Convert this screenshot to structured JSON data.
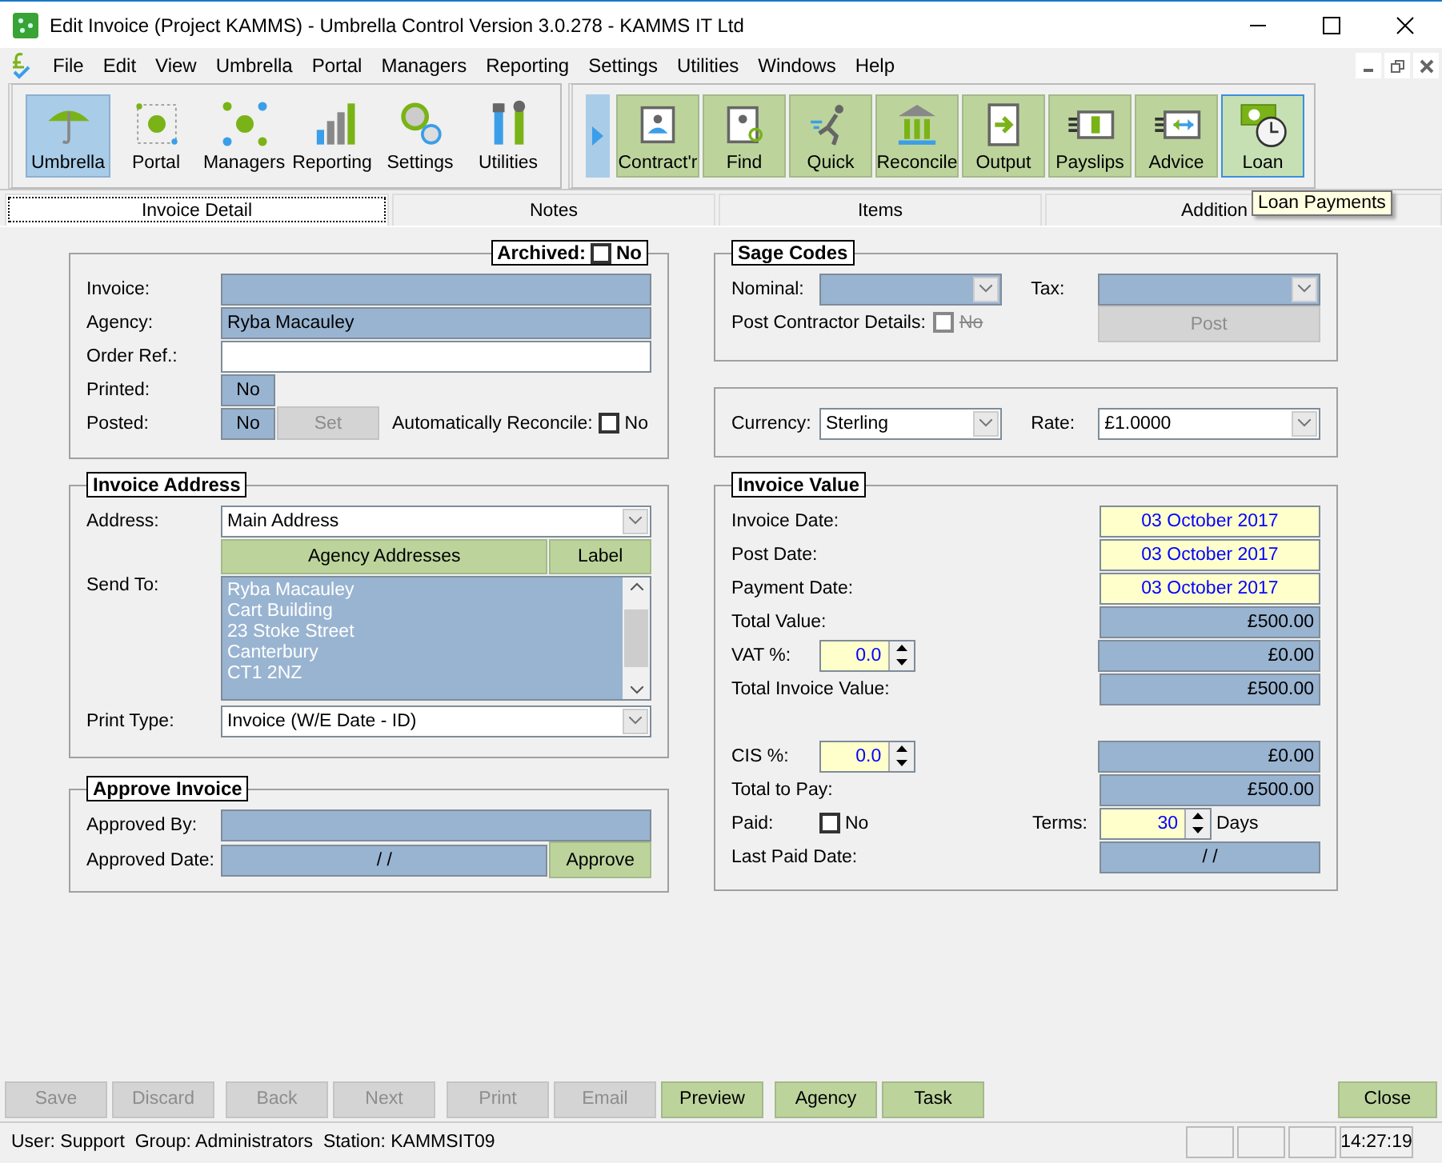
{
  "window": {
    "title": "Edit Invoice (Project KAMMS) - Umbrella Control Version 3.0.278 - KAMMS IT Ltd"
  },
  "menu": [
    "File",
    "Edit",
    "View",
    "Umbrella",
    "Portal",
    "Managers",
    "Reporting",
    "Settings",
    "Utilities",
    "Windows",
    "Help"
  ],
  "toolbar_main": [
    {
      "label": "Umbrella",
      "selected": true
    },
    {
      "label": "Portal",
      "selected": false
    },
    {
      "label": "Managers",
      "selected": false
    },
    {
      "label": "Reporting",
      "selected": false
    },
    {
      "label": "Settings",
      "selected": false
    },
    {
      "label": "Utilities",
      "selected": false
    }
  ],
  "toolbar_actions": [
    {
      "label": "Contract'r",
      "selected": false
    },
    {
      "label": "Find",
      "selected": false
    },
    {
      "label": "Quick",
      "selected": false
    },
    {
      "label": "Reconcile",
      "selected": false
    },
    {
      "label": "Output",
      "selected": false
    },
    {
      "label": "Payslips",
      "selected": false
    },
    {
      "label": "Advice",
      "selected": false
    },
    {
      "label": "Loan",
      "selected": true
    }
  ],
  "tooltip": "Loan Payments",
  "tabs": [
    {
      "label": "Invoice Detail",
      "selected": true
    },
    {
      "label": "Notes",
      "selected": false
    },
    {
      "label": "Items",
      "selected": false
    },
    {
      "label": "Addition",
      "selected": false
    }
  ],
  "details": {
    "archived": {
      "label": "Archived:",
      "checked": false,
      "text": "No"
    },
    "invoice": {
      "label": "Invoice:"
    },
    "agency": {
      "label": "Agency:",
      "value": "Ryba Macauley"
    },
    "order_ref": {
      "label": "Order Ref.:"
    },
    "printed": {
      "label": "Printed:",
      "value": "No"
    },
    "posted": {
      "label": "Posted:",
      "value": "No"
    },
    "set_button": {
      "label": "Set",
      "disabled": true
    },
    "auto_reconcile": {
      "label": "Automatically Reconcile:",
      "checked": false,
      "text": "No"
    }
  },
  "invoice_address": {
    "title": "Invoice Address",
    "address": {
      "label": "Address:",
      "value": "Main Address"
    },
    "buttons": [
      "Agency Addresses",
      "Label"
    ],
    "send_to": {
      "label": "Send To:",
      "lines": [
        "Ryba Macauley",
        "Cart Building",
        "23 Stoke Street",
        "Canterbury",
        "CT1 2NZ"
      ]
    },
    "print_type": {
      "label": "Print Type:",
      "value": "Invoice (W/E Date - ID)"
    }
  },
  "approve_invoice": {
    "title": "Approve Invoice",
    "approved_by": {
      "label": "Approved By:"
    },
    "approved_date": {
      "label": "Approved Date:",
      "value": "/ /"
    },
    "button": "Approve"
  },
  "sage_codes": {
    "title": "Sage Codes",
    "nominal": {
      "label": "Nominal:"
    },
    "tax": {
      "label": "Tax:"
    },
    "post_contractor": {
      "label": "Post Contractor Details:",
      "checked": false,
      "text": "No",
      "disabled": true
    },
    "post_button": {
      "label": "Post",
      "disabled": true
    }
  },
  "currency": {
    "label": "Currency:",
    "value": "Sterling"
  },
  "rate": {
    "label": "Rate:",
    "value": "£1.0000"
  },
  "invoice_value": {
    "title": "Invoice Value",
    "invoice_date": {
      "label": "Invoice Date:",
      "value": "03 October 2017"
    },
    "post_date": {
      "label": "Post Date:",
      "value": "03 October 2017"
    },
    "payment_date": {
      "label": "Payment Date:",
      "value": "03 October 2017"
    },
    "total_value": {
      "label": "Total Value:",
      "value": "£500.00"
    },
    "vat": {
      "label": "VAT %:",
      "rate": "0.0",
      "value": "£0.00"
    },
    "total_invoice_value": {
      "label": "Total Invoice Value:",
      "value": "£500.00"
    },
    "cis": {
      "label": "CIS %:",
      "rate": "0.0",
      "value": "£0.00"
    },
    "total_to_pay": {
      "label": "Total to Pay:",
      "value": "£500.00"
    },
    "paid": {
      "label": "Paid:",
      "checked": false,
      "text": "No"
    },
    "terms": {
      "label": "Terms:",
      "value": "30",
      "unit": "Days"
    },
    "last_paid_date": {
      "label": "Last Paid Date:",
      "value": "/ /"
    }
  },
  "bottom_buttons": [
    {
      "label": "Save",
      "disabled": true
    },
    {
      "label": "Discard",
      "disabled": true
    },
    {
      "label": "Back",
      "disabled": true
    },
    {
      "label": "Next",
      "disabled": true
    },
    {
      "label": "Print",
      "disabled": true
    },
    {
      "label": "Email",
      "disabled": true
    },
    {
      "label": "Preview",
      "disabled": false
    },
    {
      "label": "Agency",
      "disabled": false
    },
    {
      "label": "Task",
      "disabled": false
    }
  ],
  "close_button": {
    "label": "Close"
  },
  "status_bar": {
    "text": "User: Support  Group: Administrators  Station: KAMMSIT09",
    "time": "14:27:19"
  }
}
